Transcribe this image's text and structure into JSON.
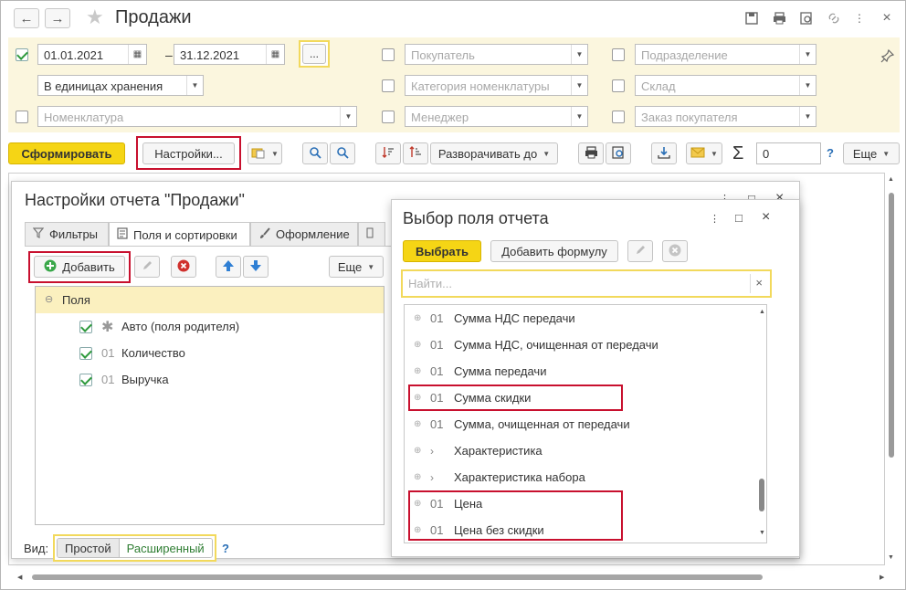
{
  "window": {
    "title": "Продажи"
  },
  "filters": {
    "period_enabled": true,
    "date_from": "01.01.2021",
    "date_separator": "–",
    "date_to": "31.12.2021",
    "dots_label": "...",
    "units": "В единицах хранения",
    "nomenclature_placeholder": "Номенклатура",
    "buyer_placeholder": "Покупатель",
    "category_placeholder": "Категория номенклатуры",
    "manager_placeholder": "Менеджер",
    "subdivision_placeholder": "Подразделение",
    "warehouse_placeholder": "Склад",
    "order_placeholder": "Заказ покупателя"
  },
  "toolbar": {
    "generate_label": "Сформировать",
    "settings_label": "Настройки...",
    "expand_label": "Разворачивать до",
    "sum_value": "0",
    "help_label": "?",
    "more_label": "Еще"
  },
  "settings_window": {
    "title": "Настройки отчета \"Продажи\"",
    "tabs": [
      "Фильтры",
      "Поля и сортировки",
      "Оформление"
    ],
    "add_label": "Добавить",
    "more_label": "Еще",
    "group_label": "Поля",
    "fields": [
      {
        "code": "*",
        "label": "Авто (поля родителя)",
        "checked": true
      },
      {
        "code": "01",
        "label": "Количество",
        "checked": true
      },
      {
        "code": "01",
        "label": "Выручка",
        "checked": true
      }
    ],
    "view_label": "Вид:",
    "view_simple": "Простой",
    "view_extended": "Расширенный",
    "help_label": "?"
  },
  "picker": {
    "title": "Выбор поля отчета",
    "select_label": "Выбрать",
    "add_formula_label": "Добавить формулу",
    "search_placeholder": "Найти...",
    "search_clear": "×",
    "items": [
      {
        "code": "01",
        "label": "Сумма НДС передачи",
        "expandable": false
      },
      {
        "code": "01",
        "label": "Сумма НДС, очищенная от передачи",
        "expandable": false
      },
      {
        "code": "01",
        "label": "Сумма передачи",
        "expandable": false
      },
      {
        "code": "01",
        "label": "Сумма скидки",
        "expandable": false
      },
      {
        "code": "01",
        "label": "Сумма, очищенная от передачи",
        "expandable": false
      },
      {
        "code": "",
        "label": "Характеристика",
        "expandable": true
      },
      {
        "code": "",
        "label": "Характеристика набора",
        "expandable": true
      },
      {
        "code": "01",
        "label": "Цена",
        "expandable": false
      },
      {
        "code": "01",
        "label": "Цена без скидки",
        "expandable": false
      }
    ]
  },
  "colors": {
    "accent_yellow": "#f5d515",
    "highlight_red": "#c8102e",
    "filter_bg": "#fbf6de"
  }
}
